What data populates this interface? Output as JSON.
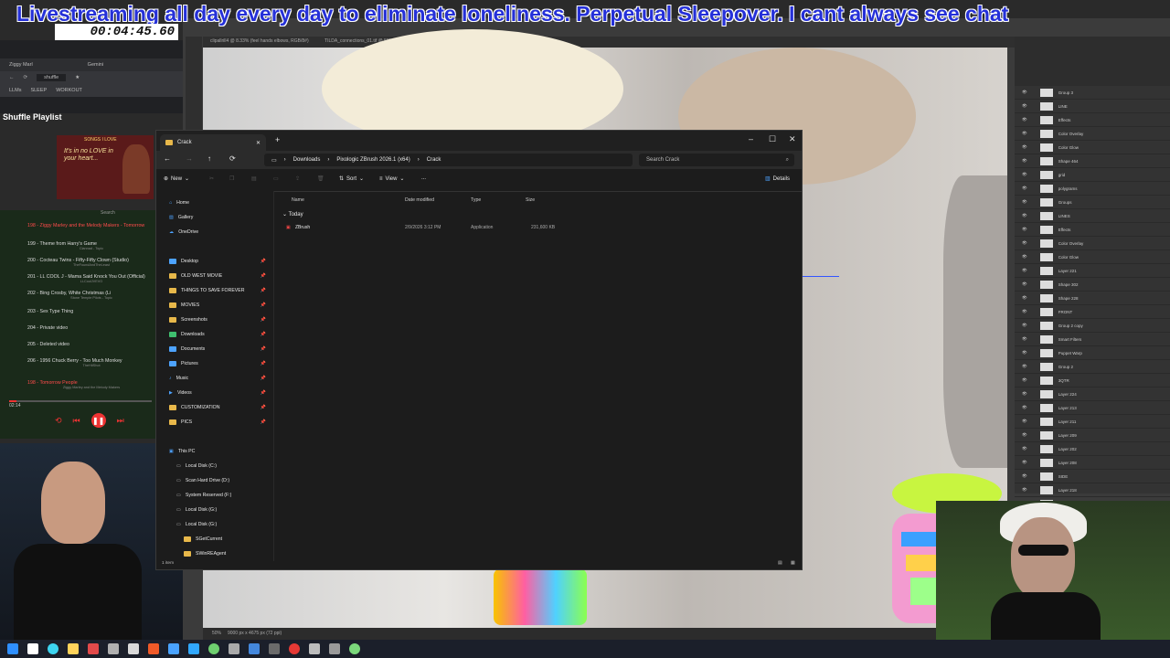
{
  "stream": {
    "banner": "Livestreaming all day every day to eliminate loneliness. Perpetual Sleepover. I cant always see chat",
    "timer": "00:04:45.60"
  },
  "photoshop": {
    "tabs": [
      "clipallrill4 @ 8.33% (feel hands elbows, RGB/8#)",
      "TILDA_connections_01.tif @ 50% (Layer 224, RGB/8#) *"
    ],
    "layers": [
      "Group 3",
      "LINE",
      "Effects",
      "Color Overlay",
      "Color Glow",
      "Shape 464",
      "grid",
      "polygrams",
      "Groups",
      "LINES",
      "Effects",
      "Color Overlay",
      "Color Glow",
      "Layer 221",
      "Shape 302",
      "Shape 228",
      "FRONT",
      "Group 2 copy",
      "Smart Filters",
      "Puppet Warp",
      "Group 2",
      "3QTR",
      "Layer 224",
      "Layer 213",
      "Layer 211",
      "Layer 209",
      "Layer 202",
      "Layer 208",
      "SIDE",
      "Layer 218",
      "Layer 229",
      "Layer 212",
      "Layer 0"
    ],
    "status": "9000 px x 4675 px (72 ppi)",
    "zoom": "50%"
  },
  "browser": {
    "tab1": "Ziggy Marl",
    "tab2": "Gemini",
    "bookmarks": [
      "LLMs",
      "SLEEP",
      "WORKOUT"
    ],
    "shuffle_search": "shuffle",
    "sidebar_title": "Shuffle Playlist",
    "songs_caption": "SONGS I LOVE",
    "songs_art_text": "It's in no LOVE in your heart...",
    "search_label": "Search"
  },
  "playlist": {
    "songs": [
      {
        "title": "198 - Ziggy Marley and the Melody Makers - Tomorrow",
        "sub": "",
        "current": true
      },
      {
        "title": "199 - Theme from Harry's Game",
        "sub": "Clannad - Topic",
        "current": false
      },
      {
        "title": "200 - Cocteau Twins - Fifty-Fifty Clown (Studio)",
        "sub": "TheFoundAndTheLeast",
        "current": false
      },
      {
        "title": "201 - LL COOL J - Mama Said Knock You Out (Official)",
        "sub": "LLCoolJVEVO",
        "current": false
      },
      {
        "title": "202 - Bing Crosby, White Christmas (Li",
        "sub": "Stone Temple Pilots - Topic",
        "current": false
      },
      {
        "title": "203 - Sex Type Thing",
        "sub": "",
        "current": false
      },
      {
        "title": "204 - Private video",
        "sub": "",
        "current": false
      },
      {
        "title": "205 - Deleted video",
        "sub": "",
        "current": false
      },
      {
        "title": "206 - 1956 Chuck Berry - Too Much Monkey",
        "sub": "TheHitShot",
        "current": false
      },
      {
        "title": "198 - Tomorrow People",
        "sub": "Ziggy Marley and the Melody Makers",
        "current": true
      }
    ],
    "elapsed": "02:14",
    "progress": 0.05
  },
  "explorer": {
    "tab_title": "Crack",
    "add_tab": "+",
    "breadcrumb": [
      "Downloads",
      "Pixologic ZBrush 2026.1 (x64)",
      "Crack"
    ],
    "search_placeholder": "Search Crack",
    "toolbar": {
      "new": "New",
      "sort": "Sort",
      "view": "View",
      "more": "...",
      "details": "Details"
    },
    "nav": {
      "quick": [
        {
          "label": "Home",
          "pinned": false,
          "kind": "home"
        },
        {
          "label": "Gallery",
          "pinned": false,
          "kind": "gallery"
        },
        {
          "label": "OneDrive",
          "pinned": false,
          "kind": "cloud"
        }
      ],
      "pinned": [
        {
          "label": "Desktop",
          "kind": "folder-blue"
        },
        {
          "label": "OLD WEST MOVIE",
          "kind": "folder"
        },
        {
          "label": "THINGS TO SAVE FOREVER",
          "kind": "folder"
        },
        {
          "label": "MOVIES",
          "kind": "folder"
        },
        {
          "label": "Screenshots",
          "kind": "folder"
        },
        {
          "label": "Downloads",
          "kind": "folder-green"
        },
        {
          "label": "Documents",
          "kind": "folder-blue"
        },
        {
          "label": "Pictures",
          "kind": "folder-blue"
        },
        {
          "label": "Music",
          "kind": "music"
        },
        {
          "label": "Videos",
          "kind": "video"
        },
        {
          "label": "CUSTOMIZATION",
          "kind": "folder"
        },
        {
          "label": "PICS",
          "kind": "folder"
        }
      ],
      "this_pc": "This PC",
      "drives": [
        "Local Disk (C:)",
        "Scan Hard Drive (D:)",
        "System Reserved (F:)",
        "Local Disk (G:)",
        "Local Disk (G:)"
      ],
      "subfolders": [
        "SGetCurrent",
        "SWinREAgent"
      ]
    },
    "columns": [
      "Name",
      "Date modified",
      "Type",
      "Size"
    ],
    "group": "Today",
    "files": [
      {
        "name": "ZBrush",
        "date": "2/9/2026 3:12 PM",
        "type": "Application",
        "size": "231,600 KB"
      }
    ],
    "status": "1 item"
  },
  "colors": {
    "banner_text": "#2530d8",
    "accent_red": "#ee3333",
    "explorer_bg": "#1c1c1c",
    "folder_yellow": "#e8b84a"
  }
}
